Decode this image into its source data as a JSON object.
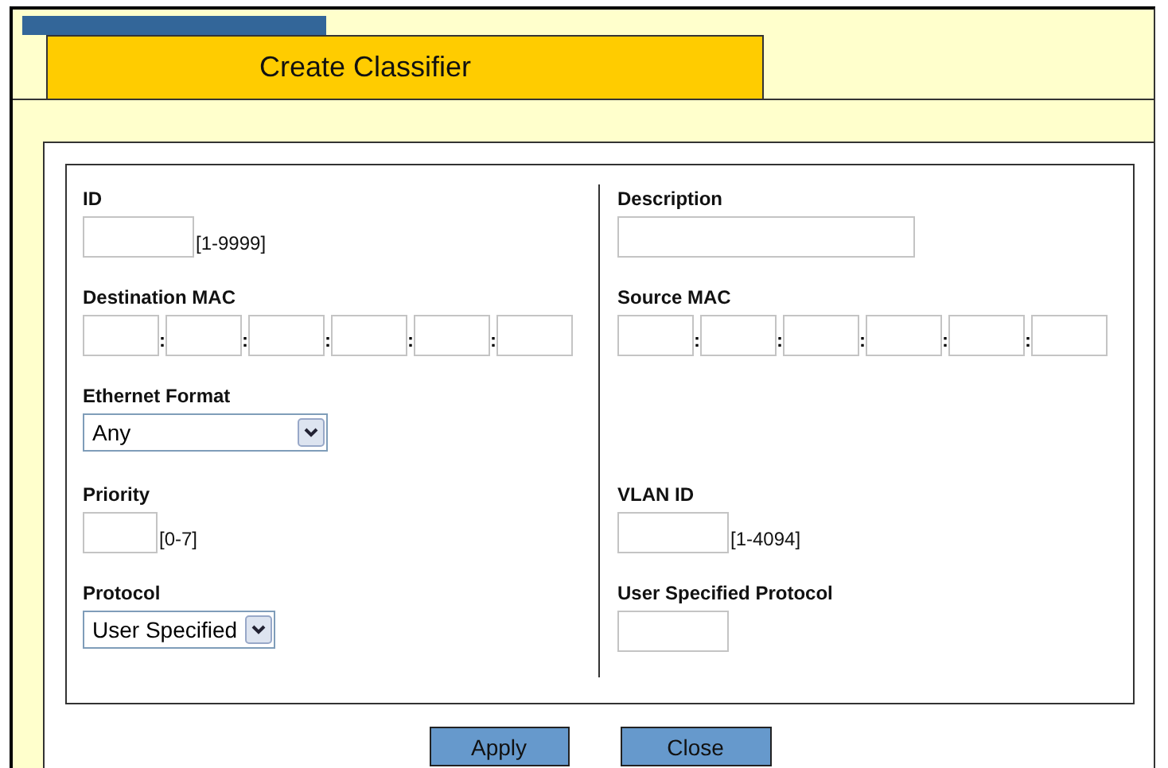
{
  "window": {
    "title": "Create Classifier"
  },
  "rows": [
    {
      "fields": [
        {
          "kind": "text",
          "label": "ID",
          "hint": "[1-9999]"
        },
        {
          "kind": "text",
          "label": "Description"
        }
      ]
    },
    {
      "fields": [
        {
          "kind": "mac",
          "label": "Destination MAC",
          "separator": ":"
        },
        {
          "kind": "mac",
          "label": "Source MAC",
          "separator": ":"
        }
      ]
    },
    {
      "fields": [
        {
          "kind": "select",
          "label": "Ethernet Format",
          "value": "Any"
        }
      ]
    },
    {
      "fields": [
        {
          "kind": "text",
          "label": "Priority",
          "hint": "[0-7]"
        },
        {
          "kind": "text",
          "label": "VLAN ID",
          "hint": "[1-4094]"
        }
      ]
    },
    {
      "fields": [
        {
          "kind": "select",
          "label": "Protocol",
          "value": "User Specified"
        },
        {
          "kind": "text",
          "label": "User Specified Protocol"
        }
      ]
    }
  ],
  "buttons": [
    "Apply",
    "Close"
  ]
}
